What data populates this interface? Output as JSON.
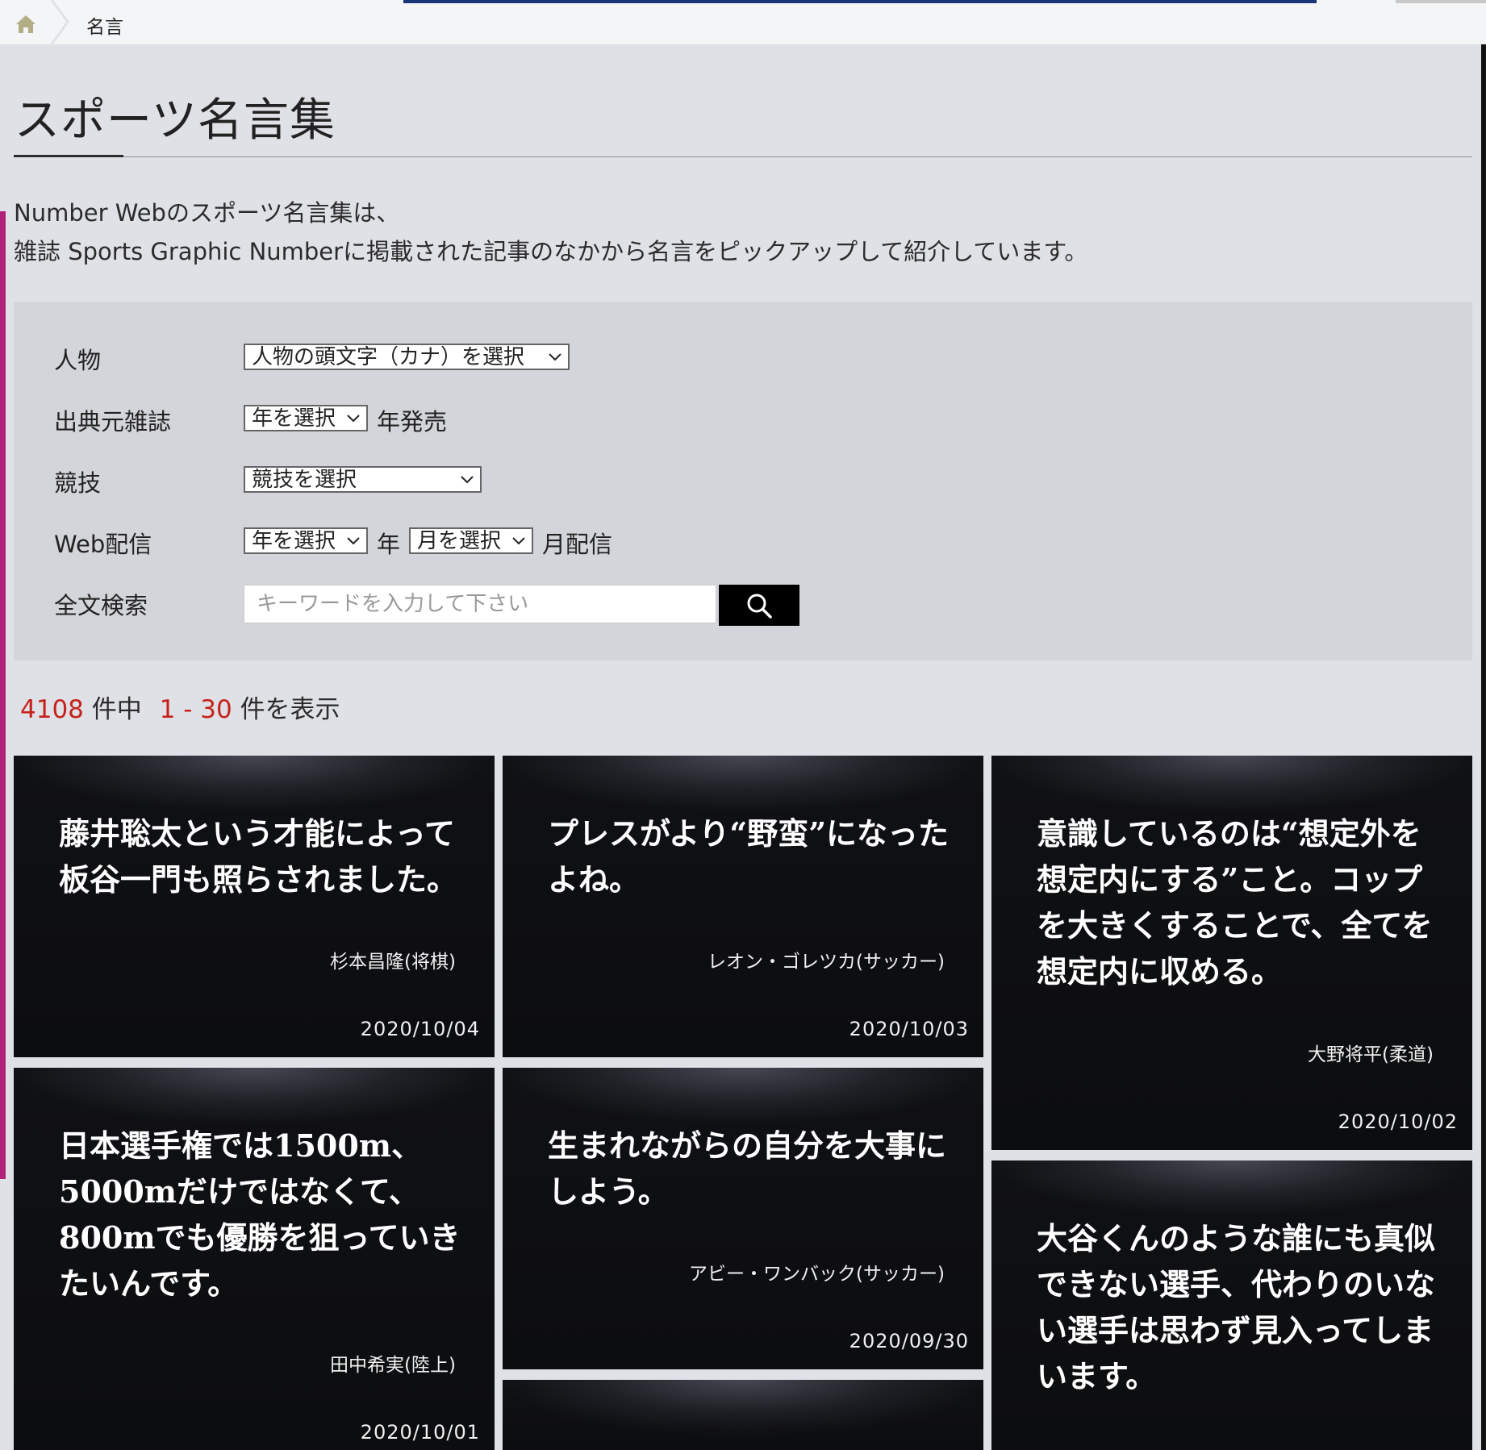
{
  "breadcrumb": {
    "home_icon": "home-icon",
    "current": "名言"
  },
  "page": {
    "title": "スポーツ名言集",
    "intro_line1": "Number Webのスポーツ名言集は、",
    "intro_line2": "雑誌 Sports Graphic Numberに掲載された記事のなかから名言をピックアップして紹介しています。"
  },
  "filters": {
    "person": {
      "label": "人物",
      "select_value": "人物の頭文字（カナ）を選択"
    },
    "magazine": {
      "label": "出典元雑誌",
      "select_value": "年を選択",
      "suffix": "年発売"
    },
    "sport": {
      "label": "競技",
      "select_value": "競技を選択"
    },
    "web": {
      "label": "Web配信",
      "year_value": "年を選択",
      "year_suffix": "年",
      "month_value": "月を選択",
      "month_suffix": "月配信"
    },
    "fulltext": {
      "label": "全文検索",
      "placeholder": "キーワードを入力して下さい",
      "button_icon": "search-icon"
    }
  },
  "results": {
    "total": "4108",
    "total_suffix": "件中",
    "range": "1 - 30",
    "range_suffix": "件を表示"
  },
  "cards": [
    {
      "quote": "藤井聡太という才能によって板谷一門も照らされました。",
      "speaker": "杉本昌隆(将棋)",
      "date": "2020/10/04"
    },
    {
      "quote": "プレスがより“野蛮”になったよね。",
      "speaker": "レオン・ゴレツカ(サッカー)",
      "date": "2020/10/03"
    },
    {
      "quote": "意識しているのは“想定外を想定内にする”こと。コップを大きくすることで、全てを想定内に収める。",
      "speaker": "大野将平(柔道)",
      "date": "2020/10/02"
    },
    {
      "quote": "日本選手権では1500m、5000mだけではなくて、800mでも優勝を狙っていきたいんです。",
      "speaker": "田中希実(陸上)",
      "date": "2020/10/01"
    },
    {
      "quote": "生まれながらの自分を大事にしよう。",
      "speaker": "アビー・ワンバック(サッカー)",
      "date": "2020/09/30"
    },
    {
      "quote": "大谷くんのような誰にも真似できない選手、代わりのいない選手は思わず見入ってしまいます。",
      "speaker": "",
      "date": ""
    },
    {
      "quote": "",
      "speaker": "",
      "date": ""
    }
  ]
}
